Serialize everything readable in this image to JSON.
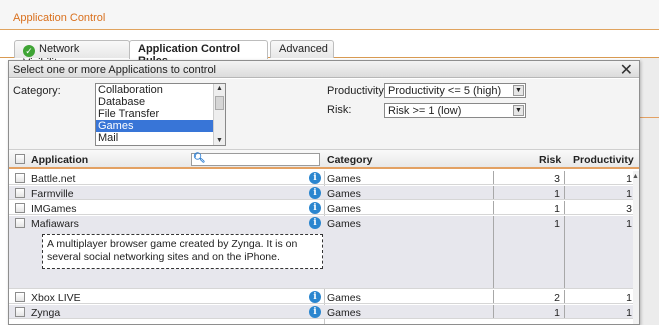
{
  "app": {
    "title": "Application Control"
  },
  "tabs": [
    {
      "label": "Network Visibility",
      "active": false,
      "icon": "check-circle-icon"
    },
    {
      "label": "Application Control Rules",
      "active": true
    },
    {
      "label": "Advanced",
      "active": false
    }
  ],
  "dialog": {
    "title": "Select one or more Applications to control",
    "close_glyph": "✕"
  },
  "filters": {
    "category_label": "Category:",
    "categories": [
      "Collaboration",
      "Database",
      "File Transfer",
      "Games",
      "Mail"
    ],
    "selected_category": "Games",
    "productivity_label": "Productivity:",
    "productivity_value": "Productivity <= 5 (high)",
    "risk_label": "Risk:",
    "risk_value": "Risk >= 1 (low)"
  },
  "table": {
    "headers": {
      "application": "Application",
      "category": "Category",
      "risk": "Risk",
      "productivity": "Productivity"
    },
    "search_value": "",
    "rows": [
      {
        "name": "Battle.net",
        "category": "Games",
        "risk": "3",
        "productivity": "1"
      },
      {
        "name": "Farmville",
        "category": "Games",
        "risk": "1",
        "productivity": "1"
      },
      {
        "name": "IMGames",
        "category": "Games",
        "risk": "1",
        "productivity": "3"
      },
      {
        "name": "Mafiawars",
        "category": "Games",
        "risk": "1",
        "productivity": "1",
        "description": "A multiplayer browser game created by Zynga. It is on several social networking sites and on the iPhone."
      },
      {
        "name": "Xbox LIVE",
        "category": "Games",
        "risk": "2",
        "productivity": "1"
      },
      {
        "name": "Zynga",
        "category": "Games",
        "risk": "1",
        "productivity": "1"
      }
    ]
  },
  "colors": {
    "accent": "#d9701d",
    "selection": "#3875d7",
    "info": "#2b86cf",
    "row_alt": "#e7e7ed"
  }
}
